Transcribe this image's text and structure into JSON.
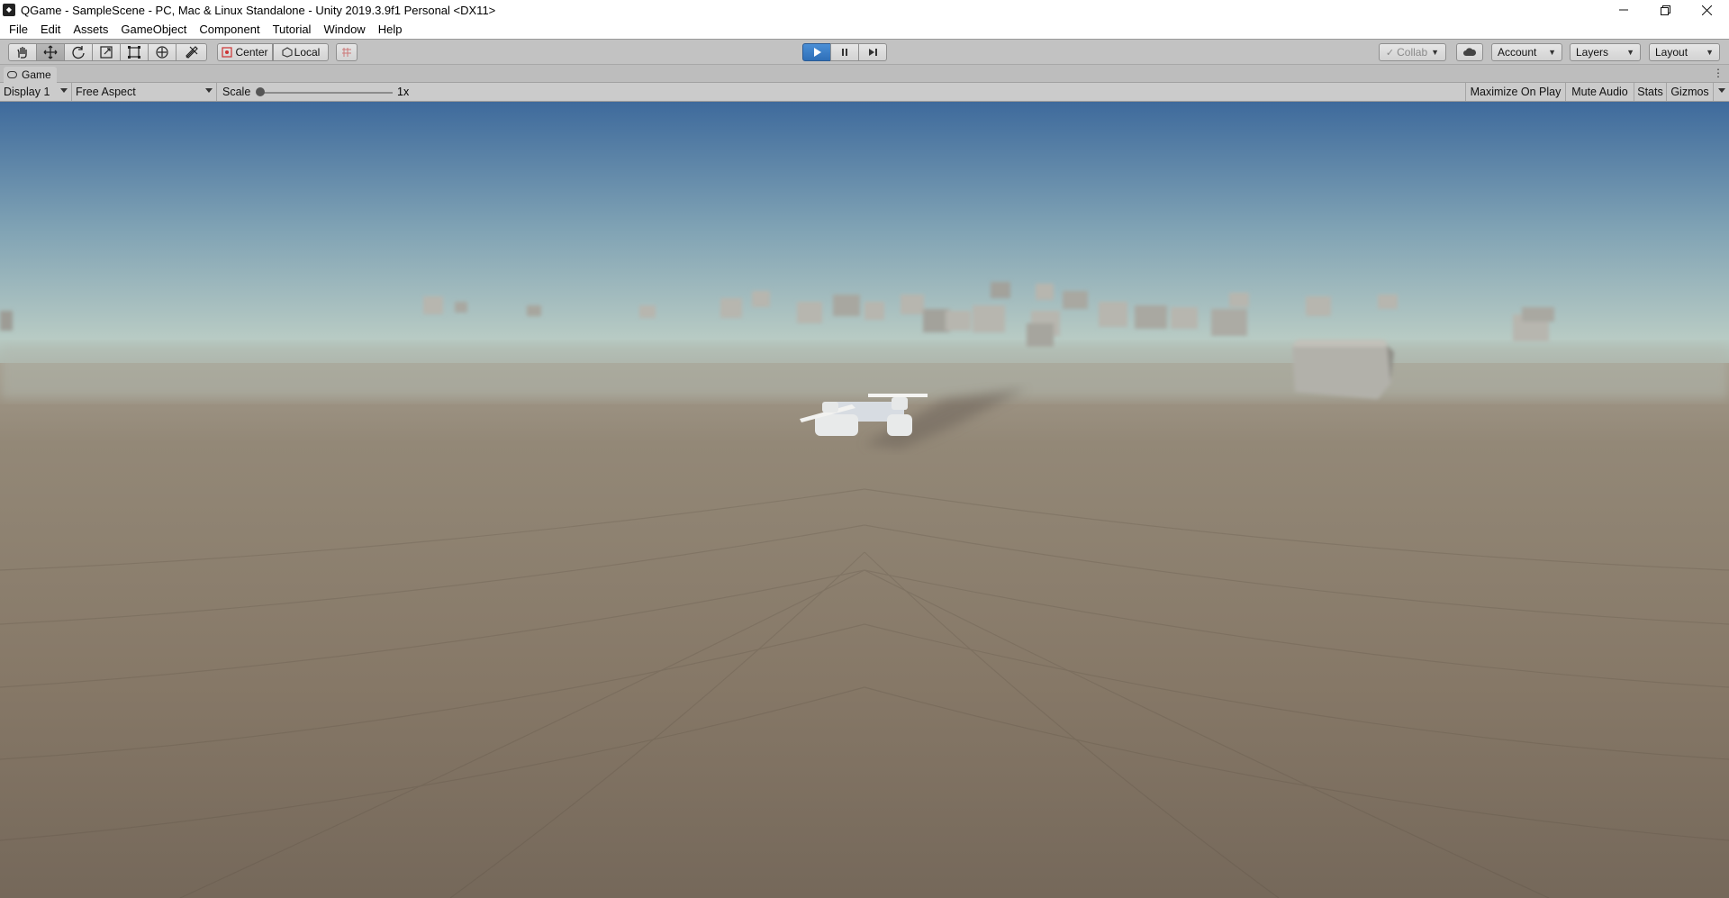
{
  "window": {
    "title": "QGame - SampleScene - PC, Mac & Linux Standalone - Unity 2019.3.9f1 Personal <DX11>",
    "controls": [
      "minimize-icon",
      "restore-icon",
      "close-icon"
    ]
  },
  "menu": {
    "items": [
      "File",
      "Edit",
      "Assets",
      "GameObject",
      "Component",
      "Tutorial",
      "Window",
      "Help"
    ]
  },
  "toolbar": {
    "tools": [
      "hand-tool-icon",
      "move-tool-icon",
      "rotate-tool-icon",
      "scale-tool-icon",
      "rect-tool-icon",
      "transform-tool-icon",
      "custom-tool-icon"
    ],
    "pivot_label": "Center",
    "space_label": "Local",
    "collab_label": "Collab",
    "account_label": "Account",
    "layers_label": "Layers",
    "layout_label": "Layout",
    "play_state": "playing",
    "accent_color": "#3b7fcf"
  },
  "game_tab": {
    "label": "Game"
  },
  "game_toolbar": {
    "display": "Display 1",
    "aspect": "Free Aspect",
    "scale_label": "Scale",
    "scale_value": "1x",
    "maximize_on_play": "Maximize On Play",
    "mute_audio": "Mute Audio",
    "stats": "Stats",
    "gizmos": "Gizmos"
  },
  "scene": {
    "sky_top_color": "#3e6a9c",
    "horizon_color": "#b8cbc4",
    "ground_color": "#8a7b68"
  }
}
